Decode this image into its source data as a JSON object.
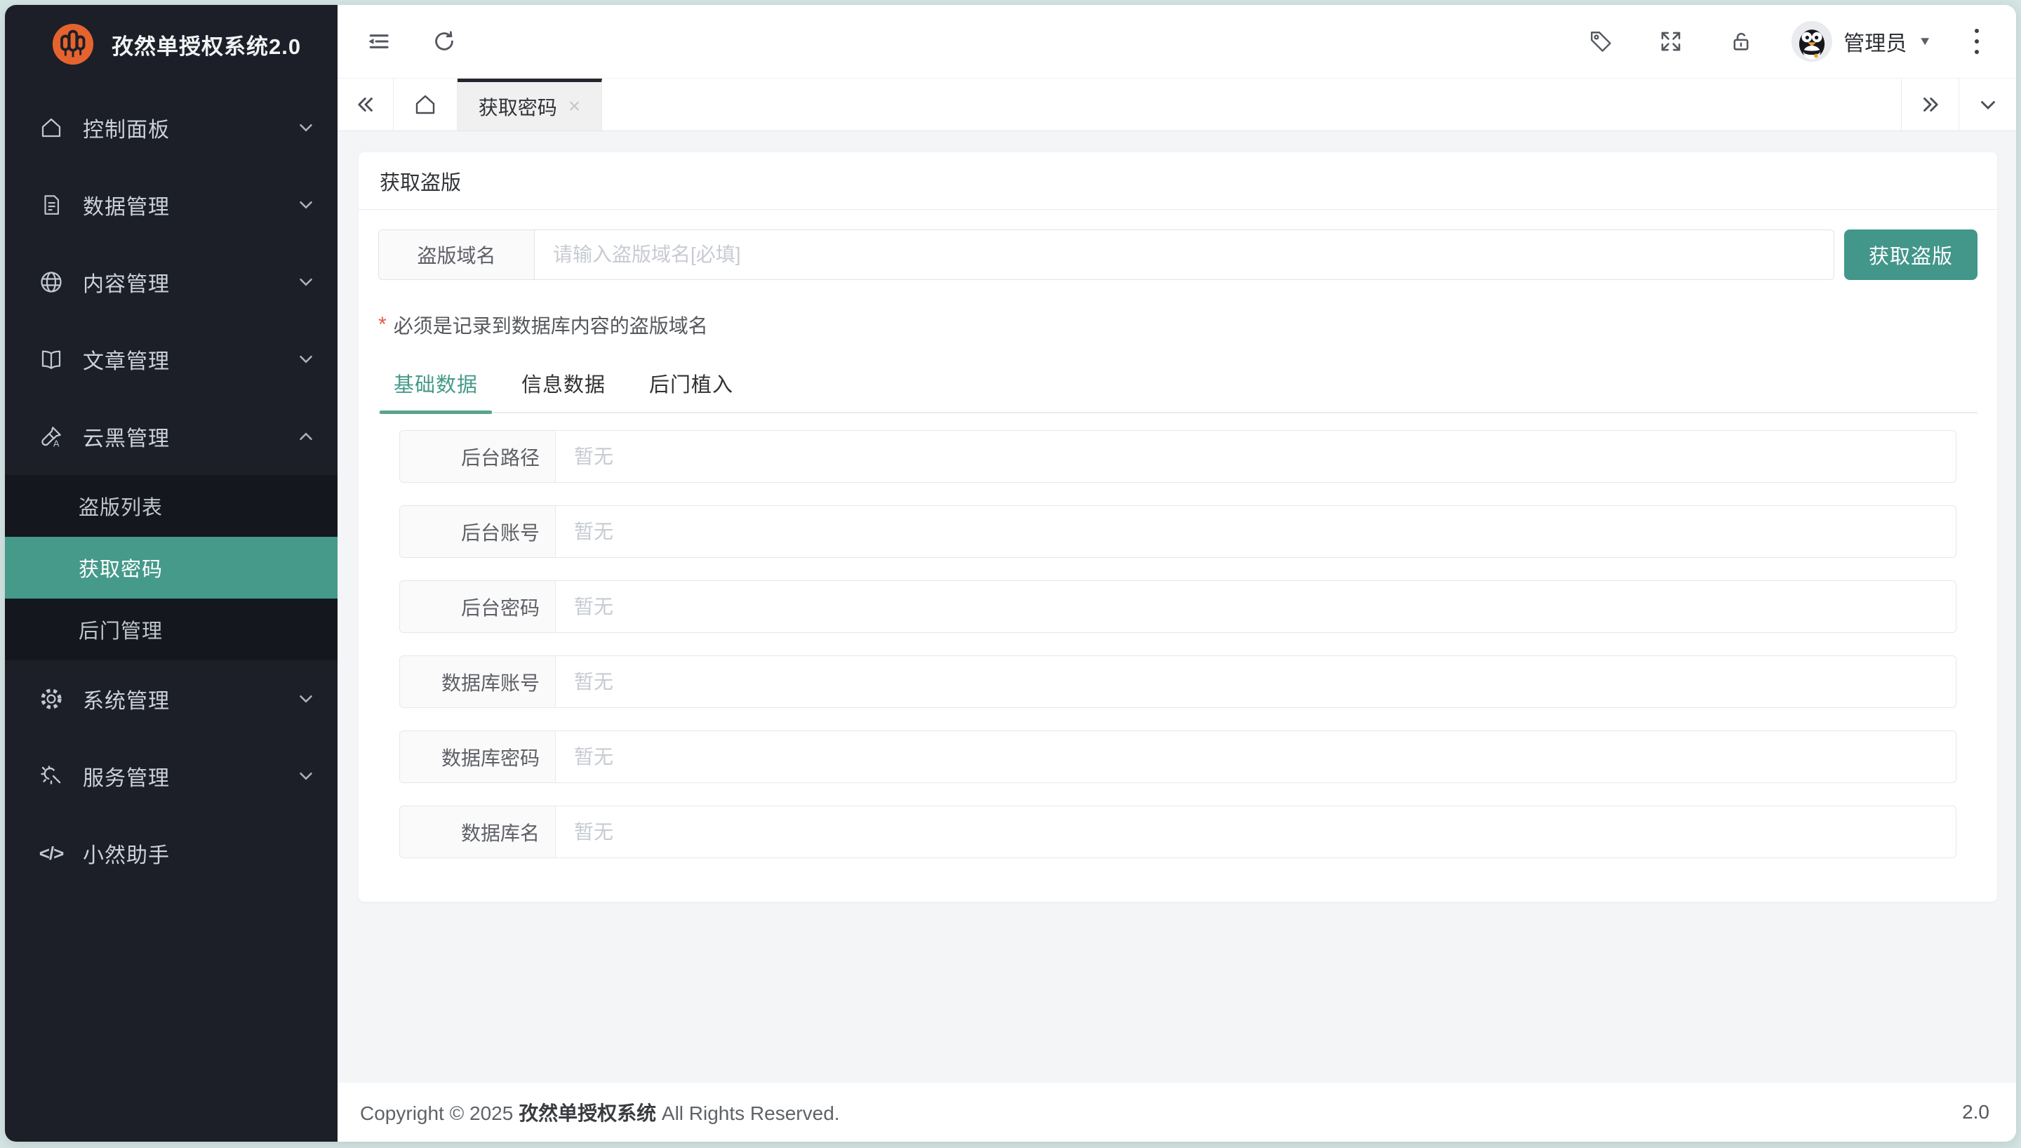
{
  "app": {
    "title": "孜然单授权系统2.0"
  },
  "topbar": {
    "user": "管理员",
    "caret_glyph": "▼",
    "icons": {
      "tag": "tag-icon",
      "fullscreen": "fullscreen-icon",
      "lock": "unlock-icon",
      "collapse": "collapse-menu-icon",
      "refresh": "refresh-icon",
      "more": "kebab-menu-icon"
    }
  },
  "tabbar": {
    "active_tab": "获取密码",
    "close_glyph": "×"
  },
  "sidebar": {
    "items": [
      {
        "label": "控制面板",
        "icon": "home-icon"
      },
      {
        "label": "数据管理",
        "icon": "document-icon"
      },
      {
        "label": "内容管理",
        "icon": "globe-icon"
      },
      {
        "label": "文章管理",
        "icon": "book-icon"
      },
      {
        "label": "云黑管理",
        "icon": "paint-brush-icon",
        "expanded": true,
        "children": [
          {
            "label": "盗版列表",
            "active": false
          },
          {
            "label": "获取密码",
            "active": true
          },
          {
            "label": "后门管理",
            "active": false
          }
        ]
      },
      {
        "label": "系统管理",
        "icon": "gear-icon"
      },
      {
        "label": "服务管理",
        "icon": "service-icon"
      },
      {
        "label": "小然助手",
        "icon": "code-icon",
        "code_glyph": "</>"
      }
    ]
  },
  "card": {
    "title": "获取盗版",
    "domain_label": "盗版域名",
    "domain_placeholder": "请输入盗版域名[必填]",
    "submit_button": "获取盗版",
    "required_mark": "*",
    "note": "必须是记录到数据库内容的盗版域名",
    "tabs": [
      "基础数据",
      "信息数据",
      "后门植入"
    ],
    "active_tab": "基础数据",
    "fields": [
      {
        "label": "后台路径",
        "placeholder": "暂无"
      },
      {
        "label": "后台账号",
        "placeholder": "暂无"
      },
      {
        "label": "后台密码",
        "placeholder": "暂无"
      },
      {
        "label": "数据库账号",
        "placeholder": "暂无"
      },
      {
        "label": "数据库密码",
        "placeholder": "暂无"
      },
      {
        "label": "数据库名",
        "placeholder": "暂无"
      }
    ]
  },
  "footer": {
    "copyright_prefix": "Copyright © 2025 ",
    "brand": "孜然单授权系统",
    "copyright_suffix": " All Rights Reserved.",
    "version": "2.0"
  },
  "colors": {
    "accent_teal": "#459a89",
    "button_teal": "#42968a",
    "sidebar_bg": "#1c1f27",
    "submenu_bg": "#15171e",
    "logo_orange": "#e5632e",
    "content_bg": "#f3f5f7",
    "frame_bg": "#d3e4e2",
    "required_red": "#e25f3f"
  }
}
